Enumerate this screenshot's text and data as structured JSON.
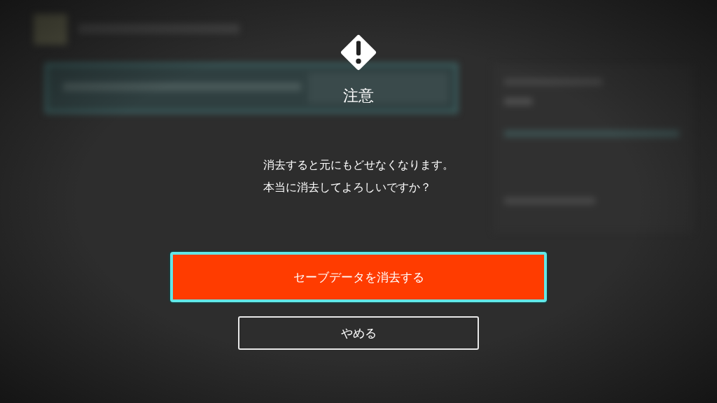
{
  "dialog": {
    "title": "注意",
    "message": [
      "消去すると元にもどせなくなります。",
      "本当に消去してよろしいですか？"
    ],
    "buttons": [
      {
        "label": "セーブデータを消去する",
        "kind": "danger",
        "selected": true
      },
      {
        "label": "やめる",
        "kind": "outline",
        "selected": false
      }
    ]
  }
}
